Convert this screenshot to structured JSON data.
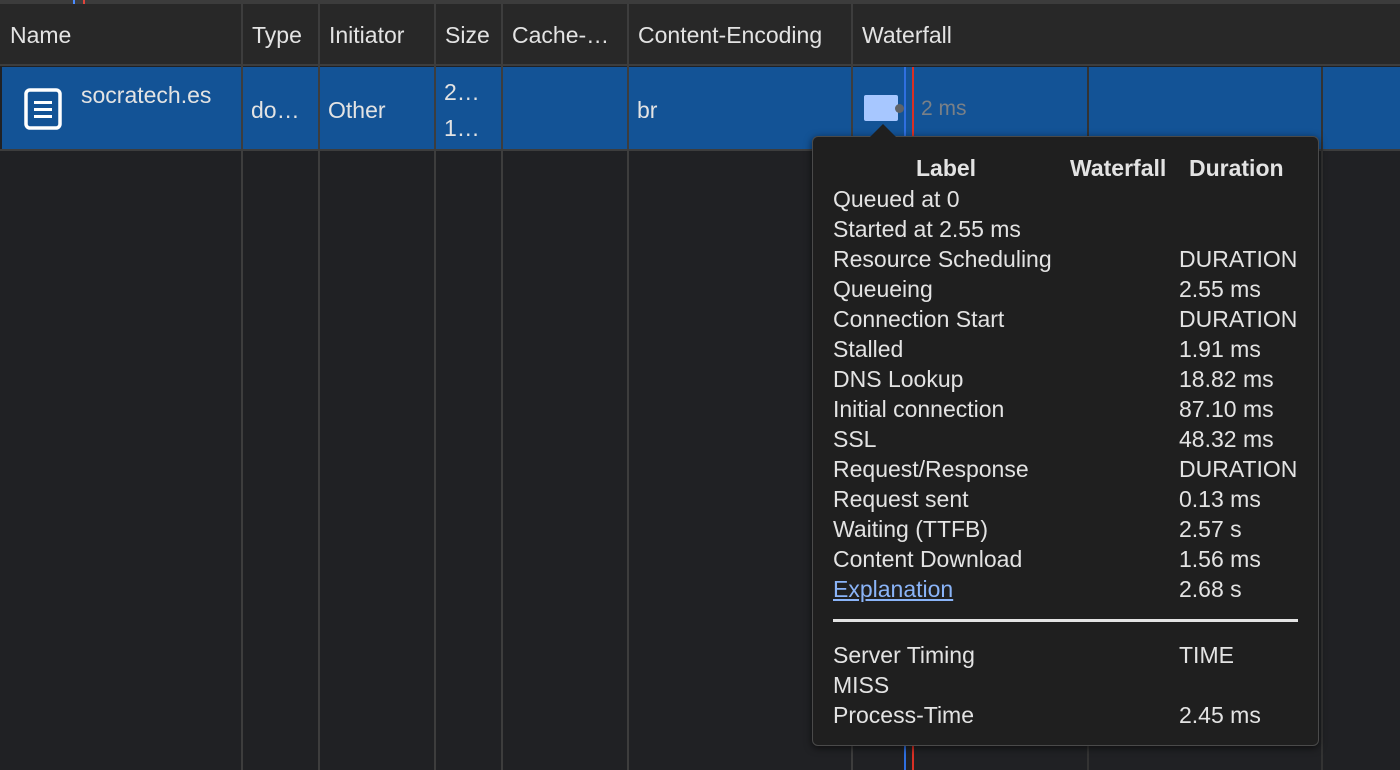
{
  "columns": [
    {
      "id": "name",
      "label": "Name"
    },
    {
      "id": "type",
      "label": "Type"
    },
    {
      "id": "initiator",
      "label": "Initiator"
    },
    {
      "id": "size",
      "label": "Size"
    },
    {
      "id": "cache",
      "label": "Cache-…"
    },
    {
      "id": "content_encoding",
      "label": "Content-Encoding"
    },
    {
      "id": "waterfall",
      "label": "Waterfall"
    }
  ],
  "request": {
    "name": "socratech.es",
    "icon": "document-icon",
    "type": "do…",
    "initiator": "Other",
    "size_line1": "2…",
    "size_line2": "1…",
    "cache": "",
    "content_encoding": "br",
    "waterfall_label": "2 ms"
  },
  "timing_tooltip": {
    "headers": {
      "label": "Label",
      "waterfall": "Waterfall",
      "duration": "Duration"
    },
    "rows": [
      {
        "label": "Queued at 0",
        "value": ""
      },
      {
        "label": "Started at 2.55 ms",
        "value": ""
      },
      {
        "label": "Resource Scheduling",
        "value": "DURATION"
      },
      {
        "label": "Queueing",
        "value": "2.55 ms"
      },
      {
        "label": "Connection Start",
        "value": "DURATION"
      },
      {
        "label": "Stalled",
        "value": "1.91 ms"
      },
      {
        "label": "DNS Lookup",
        "value": "18.82 ms"
      },
      {
        "label": "Initial connection",
        "value": "87.10 ms"
      },
      {
        "label": "SSL",
        "value": "48.32 ms"
      },
      {
        "label": "Request/Response",
        "value": "DURATION"
      },
      {
        "label": "Request sent",
        "value": "0.13 ms"
      },
      {
        "label": "Waiting (TTFB)",
        "value": "2.57 s"
      },
      {
        "label": "Content Download",
        "value": "1.56 ms"
      },
      {
        "label": "Explanation",
        "value": "2.68 s"
      }
    ],
    "server_timing": [
      {
        "label": "Server Timing",
        "value": "TIME"
      },
      {
        "label": "MISS",
        "value": ""
      },
      {
        "label": "Process-Time",
        "value": "2.45 ms"
      }
    ]
  },
  "colors": {
    "background": "#202124",
    "header_bg": "#282828",
    "selected_row": "#135396",
    "waterfall_bar": "#a7c7ff",
    "link": "#8ab4f8"
  }
}
